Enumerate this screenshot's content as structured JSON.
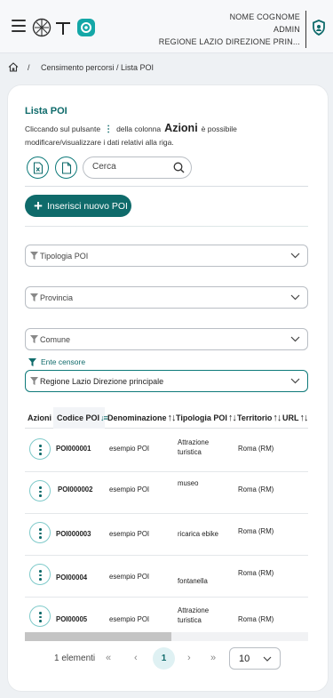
{
  "header": {
    "user_name": "NOME COGNOME",
    "role": "ADMIN",
    "organization": "REGIONE LAZIO DIREZIONE PRIN..."
  },
  "breadcrumb": {
    "separator": "/",
    "path": "Censimento percorsi / Lista POI"
  },
  "page": {
    "title": "Lista POI",
    "desc_part1": "Cliccando sul pulsante",
    "desc_dots": "⋮",
    "desc_part2": "della colonna",
    "desc_azioni": "Azioni",
    "desc_part3": "è possibile modificare/visualizzare i dati relativi alla riga."
  },
  "toolbar": {
    "search_placeholder": "Cerca",
    "add_label": "Inserisci nuovo POI"
  },
  "filters": {
    "tipologia": "Tipologia POI",
    "provincia": "Provincia",
    "comune": "Comune",
    "ente_label": "Ente censore",
    "ente_value": "Regione Lazio Direzione principale"
  },
  "table": {
    "columns": [
      "Azioni",
      "Codice POI",
      "Denominazione",
      "Tipologia POI",
      "Territorio",
      "URL"
    ],
    "rows": [
      {
        "code": "POI000001",
        "name": "esempio POI",
        "type_line1": "Attrazione",
        "type_line2": "turistica",
        "territory": "Roma (RM)"
      },
      {
        "code": "POI000002",
        "name": "esempio POI",
        "type_line1": "museo",
        "type_line2": "",
        "territory": "Roma (RM)"
      },
      {
        "code": "POI000003",
        "name": "esempio POI",
        "type_line1": "ricarica ebike",
        "type_line2": "",
        "territory": "Roma (RM)"
      },
      {
        "code": "POI00004",
        "name": "esempio POI",
        "type_line1": "fontanella",
        "type_line2": "",
        "territory": "Roma (RM)"
      },
      {
        "code": "POI00005",
        "name": "esempio POI",
        "type_line1": "Attrazione",
        "type_line2": "turistica",
        "territory": "Roma (RM)"
      }
    ]
  },
  "pagination": {
    "count": "1 elementi",
    "first": "«",
    "prev": "‹",
    "current": "1",
    "next": "›",
    "last": "»",
    "page_size": "10"
  },
  "colors": {
    "primary": "#0f6b6b",
    "accent_light": "#dff1f3"
  }
}
